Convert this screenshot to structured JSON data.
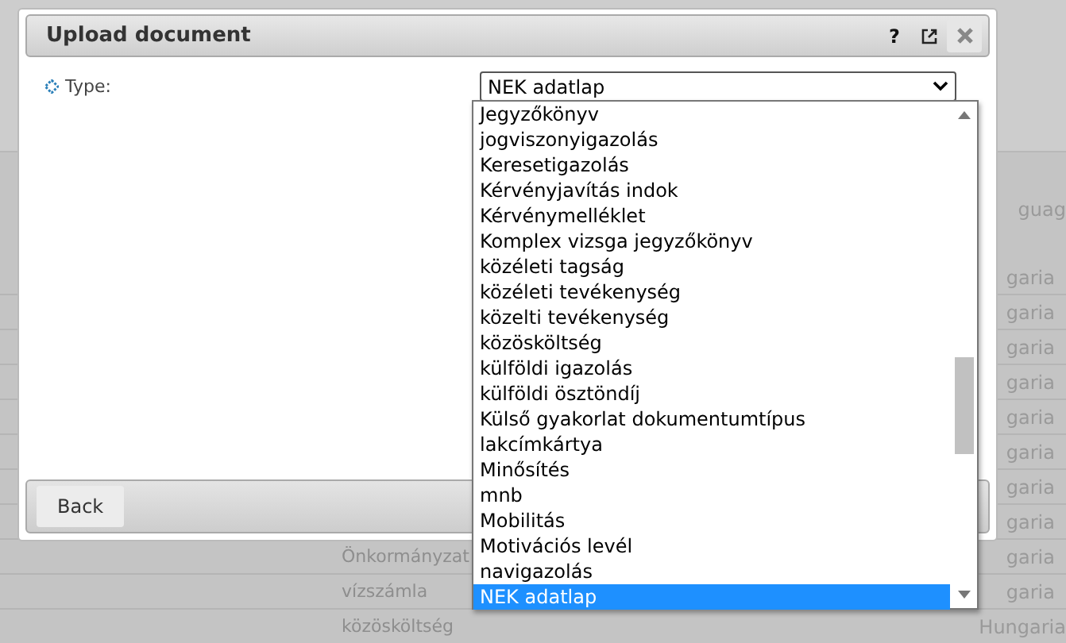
{
  "background_table": {
    "header": "guag",
    "rows": [
      {
        "column_2": "garia"
      },
      {
        "column_2": "garia"
      },
      {
        "column_2": "garia"
      },
      {
        "column_2": "garia"
      },
      {
        "column_2": "garia"
      },
      {
        "column_2": "garia"
      },
      {
        "column_2": "garia"
      },
      {
        "column_2": "garia"
      },
      {
        "column_1": "Önkormányzat",
        "column_2": "garia"
      },
      {
        "column_1": "vízszámla",
        "column_2": "garia"
      },
      {
        "column_1": "közösköltség",
        "column_2": "Hungaria"
      }
    ]
  },
  "dialog": {
    "title": "Upload document",
    "header_buttons": [
      {
        "kind": "help",
        "label": "?"
      },
      {
        "kind": "popout"
      },
      {
        "kind": "close"
      }
    ],
    "field": {
      "label": "Type:",
      "value": "NEK adatlap",
      "options": [
        {
          "label": "Jegyzőkönyv",
          "selected": false
        },
        {
          "label": "jogviszonyigazolás",
          "selected": false
        },
        {
          "label": "Keresetigazolás",
          "selected": false
        },
        {
          "label": "Kérvényjavítás indok",
          "selected": false
        },
        {
          "label": "Kérvénymelléklet",
          "selected": false
        },
        {
          "label": "Komplex vizsga jegyzőkönyv",
          "selected": false
        },
        {
          "label": "közéleti tagság",
          "selected": false
        },
        {
          "label": "közéleti tevékenység",
          "selected": false
        },
        {
          "label": "közelti tevékenység",
          "selected": false
        },
        {
          "label": "közösköltség",
          "selected": false
        },
        {
          "label": "külföldi igazolás",
          "selected": false
        },
        {
          "label": "külföldi ösztöndíj",
          "selected": false
        },
        {
          "label": "Külső gyakorlat dokumentumtípus",
          "selected": false
        },
        {
          "label": "lakcímkártya",
          "selected": false
        },
        {
          "label": "Minősítés",
          "selected": false
        },
        {
          "label": "mnb",
          "selected": false
        },
        {
          "label": "Mobilitás",
          "selected": false
        },
        {
          "label": "Motivációs levél",
          "selected": false
        },
        {
          "label": "navigazolás",
          "selected": false
        },
        {
          "label": "NEK adatlap",
          "selected": true
        }
      ]
    },
    "footer_buttons": [
      "Back"
    ]
  }
}
